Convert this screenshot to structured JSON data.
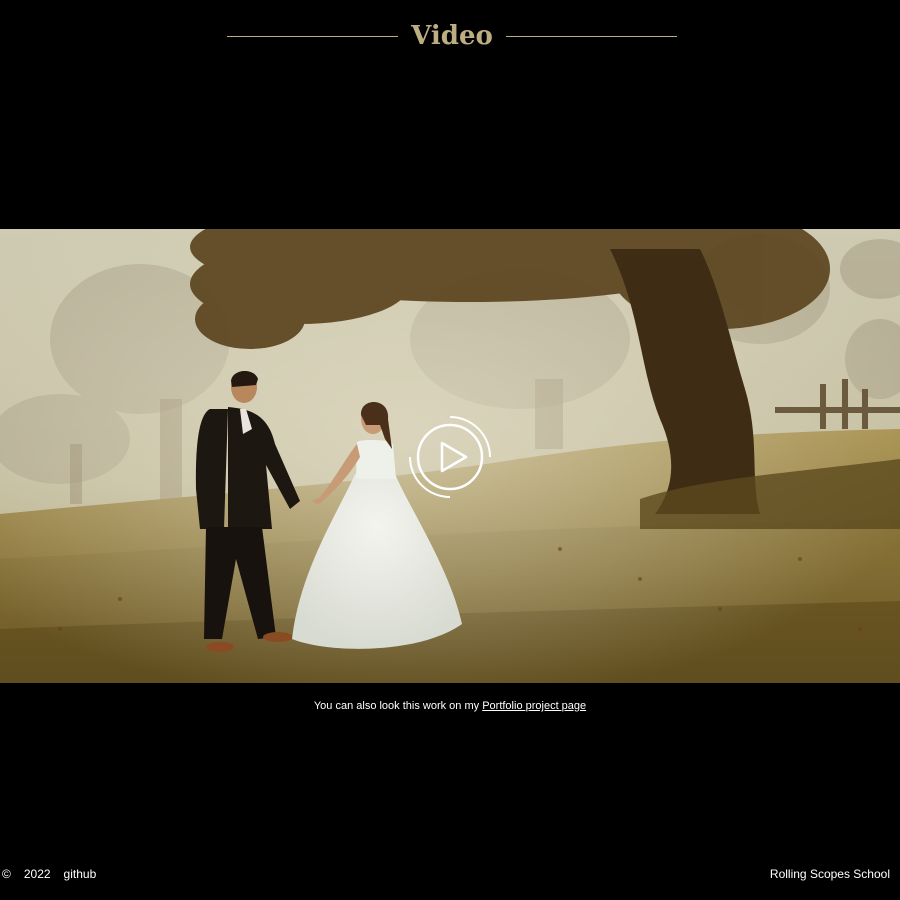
{
  "section": {
    "title": "Video"
  },
  "video": {
    "poster_description_icon": "play-icon"
  },
  "caption": {
    "text": "You can also look this work on my ",
    "link_label": "Portfolio project page"
  },
  "footer": {
    "copyright_symbol": "©",
    "year": "2022",
    "github_label": "github",
    "school_label": "Rolling Scopes School"
  },
  "colors": {
    "background": "#000000",
    "accent_gold": "#bdae82",
    "text": "#ffffff"
  }
}
